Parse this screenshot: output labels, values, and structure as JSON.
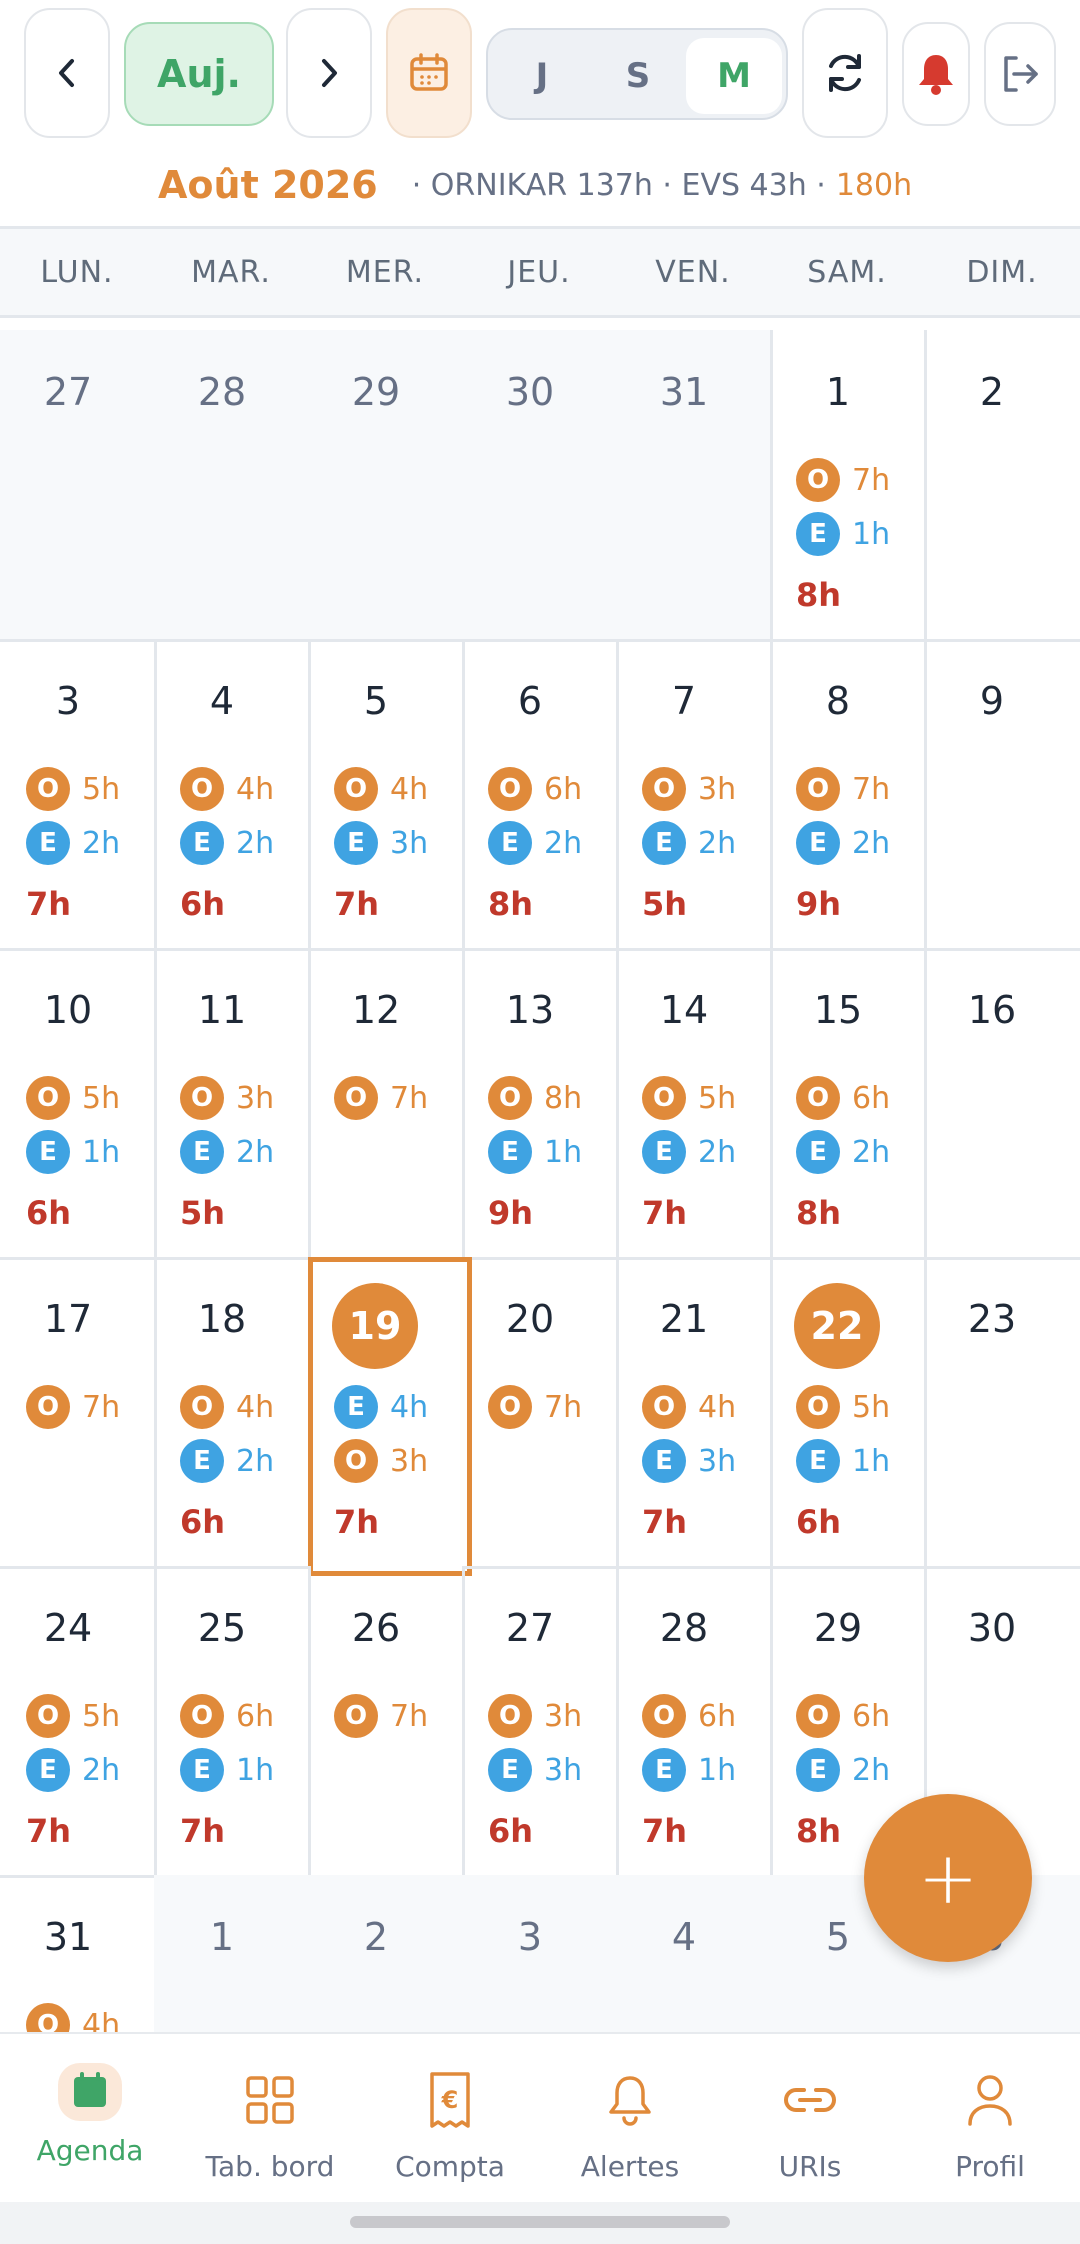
{
  "toolbar": {
    "today_label": "Auj.",
    "views": [
      {
        "label": "J",
        "active": false
      },
      {
        "label": "S",
        "active": false
      },
      {
        "label": "M",
        "active": true
      }
    ],
    "icons": [
      "chevron-left-icon",
      "chevron-right-icon",
      "calendar-icon",
      "refresh-icon",
      "bell-icon",
      "logout-icon"
    ]
  },
  "header": {
    "month": "Août 2026",
    "summary": "· ORNIKAR 137h · EVS 43h ·",
    "total": "180h"
  },
  "weekdays": [
    "LUN.",
    "MAR.",
    "MER.",
    "JEU.",
    "VEN.",
    "SAM.",
    "DIM."
  ],
  "weeks": [
    [
      {
        "day": "27",
        "out": true
      },
      {
        "day": "28",
        "out": true
      },
      {
        "day": "29",
        "out": true
      },
      {
        "day": "30",
        "out": true
      },
      {
        "day": "31",
        "out": true
      },
      {
        "day": "1",
        "events": [
          {
            "type": "O",
            "hours": "7h"
          },
          {
            "type": "E",
            "hours": "1h"
          }
        ],
        "total": "8h"
      },
      {
        "day": "2"
      }
    ],
    [
      {
        "day": "3",
        "events": [
          {
            "type": "O",
            "hours": "5h"
          },
          {
            "type": "E",
            "hours": "2h"
          }
        ],
        "total": "7h"
      },
      {
        "day": "4",
        "events": [
          {
            "type": "O",
            "hours": "4h"
          },
          {
            "type": "E",
            "hours": "2h"
          }
        ],
        "total": "6h"
      },
      {
        "day": "5",
        "events": [
          {
            "type": "O",
            "hours": "4h"
          },
          {
            "type": "E",
            "hours": "3h"
          }
        ],
        "total": "7h"
      },
      {
        "day": "6",
        "events": [
          {
            "type": "O",
            "hours": "6h"
          },
          {
            "type": "E",
            "hours": "2h"
          }
        ],
        "total": "8h"
      },
      {
        "day": "7",
        "events": [
          {
            "type": "O",
            "hours": "3h"
          },
          {
            "type": "E",
            "hours": "2h"
          }
        ],
        "total": "5h"
      },
      {
        "day": "8",
        "events": [
          {
            "type": "O",
            "hours": "7h"
          },
          {
            "type": "E",
            "hours": "2h"
          }
        ],
        "total": "9h"
      },
      {
        "day": "9"
      }
    ],
    [
      {
        "day": "10",
        "events": [
          {
            "type": "O",
            "hours": "5h"
          },
          {
            "type": "E",
            "hours": "1h"
          }
        ],
        "total": "6h"
      },
      {
        "day": "11",
        "events": [
          {
            "type": "O",
            "hours": "3h"
          },
          {
            "type": "E",
            "hours": "2h"
          }
        ],
        "total": "5h"
      },
      {
        "day": "12",
        "events": [
          {
            "type": "O",
            "hours": "7h"
          }
        ]
      },
      {
        "day": "13",
        "events": [
          {
            "type": "O",
            "hours": "8h"
          },
          {
            "type": "E",
            "hours": "1h"
          }
        ],
        "total": "9h"
      },
      {
        "day": "14",
        "events": [
          {
            "type": "O",
            "hours": "5h"
          },
          {
            "type": "E",
            "hours": "2h"
          }
        ],
        "total": "7h"
      },
      {
        "day": "15",
        "events": [
          {
            "type": "O",
            "hours": "6h"
          },
          {
            "type": "E",
            "hours": "2h"
          }
        ],
        "total": "8h"
      },
      {
        "day": "16"
      }
    ],
    [
      {
        "day": "17",
        "events": [
          {
            "type": "O",
            "hours": "7h"
          }
        ]
      },
      {
        "day": "18",
        "events": [
          {
            "type": "O",
            "hours": "4h"
          },
          {
            "type": "E",
            "hours": "2h"
          }
        ],
        "total": "6h"
      },
      {
        "day": "19",
        "highlight": true,
        "today": true,
        "events": [
          {
            "type": "E",
            "hours": "4h"
          },
          {
            "type": "O",
            "hours": "3h"
          }
        ],
        "total": "7h"
      },
      {
        "day": "20",
        "events": [
          {
            "type": "O",
            "hours": "7h"
          }
        ]
      },
      {
        "day": "21",
        "events": [
          {
            "type": "O",
            "hours": "4h"
          },
          {
            "type": "E",
            "hours": "3h"
          }
        ],
        "total": "7h"
      },
      {
        "day": "22",
        "highlight": true,
        "events": [
          {
            "type": "O",
            "hours": "5h"
          },
          {
            "type": "E",
            "hours": "1h"
          }
        ],
        "total": "6h"
      },
      {
        "day": "23"
      }
    ],
    [
      {
        "day": "24",
        "events": [
          {
            "type": "O",
            "hours": "5h"
          },
          {
            "type": "E",
            "hours": "2h"
          }
        ],
        "total": "7h"
      },
      {
        "day": "25",
        "events": [
          {
            "type": "O",
            "hours": "6h"
          },
          {
            "type": "E",
            "hours": "1h"
          }
        ],
        "total": "7h"
      },
      {
        "day": "26",
        "events": [
          {
            "type": "O",
            "hours": "7h"
          }
        ]
      },
      {
        "day": "27",
        "events": [
          {
            "type": "O",
            "hours": "3h"
          },
          {
            "type": "E",
            "hours": "3h"
          }
        ],
        "total": "6h"
      },
      {
        "day": "28",
        "events": [
          {
            "type": "O",
            "hours": "6h"
          },
          {
            "type": "E",
            "hours": "1h"
          }
        ],
        "total": "7h"
      },
      {
        "day": "29",
        "events": [
          {
            "type": "O",
            "hours": "6h"
          },
          {
            "type": "E",
            "hours": "2h"
          }
        ],
        "total": "8h"
      },
      {
        "day": "30"
      }
    ],
    [
      {
        "day": "31",
        "events": [
          {
            "type": "O",
            "hours": "4h"
          }
        ]
      },
      {
        "day": "1",
        "out": true
      },
      {
        "day": "2",
        "out": true
      },
      {
        "day": "3",
        "out": true
      },
      {
        "day": "4",
        "out": true
      },
      {
        "day": "5",
        "out": true
      },
      {
        "day": "6",
        "out": true
      }
    ]
  ],
  "badge_letters": {
    "O": "O",
    "E": "E"
  },
  "fab_label": "+",
  "nav": [
    {
      "label": "Agenda",
      "icon": "calendar-icon",
      "active": true
    },
    {
      "label": "Tab. bord",
      "icon": "dashboard-icon"
    },
    {
      "label": "Compta",
      "icon": "receipt-euro-icon"
    },
    {
      "label": "Alertes",
      "icon": "bell-icon"
    },
    {
      "label": "URIs",
      "icon": "link-icon"
    },
    {
      "label": "Profil",
      "icon": "user-icon"
    }
  ],
  "colors": {
    "accent": "#e08a3a",
    "green": "#3fa567",
    "ornikar": "#e08a3a",
    "evs": "#3fa3e2",
    "total": "#c0392b"
  }
}
